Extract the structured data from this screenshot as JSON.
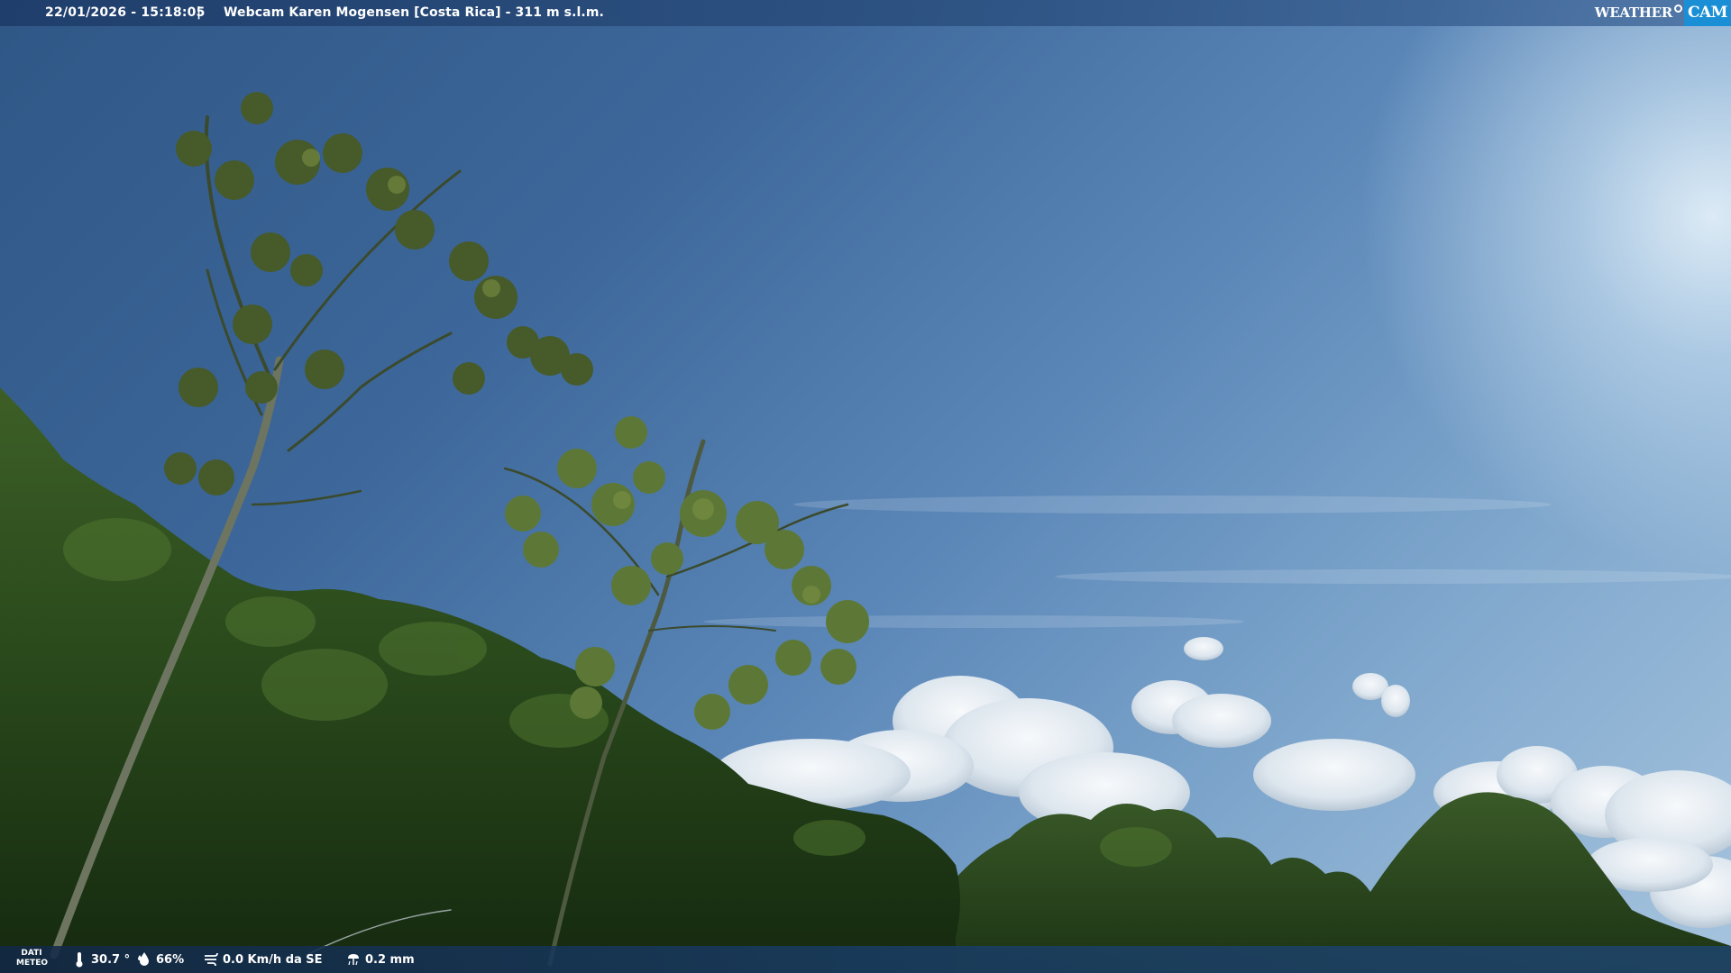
{
  "header": {
    "datetime": "22/01/2026 - 15:18:05",
    "separator": "|",
    "title": "Webcam Karen Mogensen [Costa Rica] - 311 m s.l.m."
  },
  "logo": {
    "word": "WEATHER",
    "cam": "CAM",
    "accent": "#1a8fd6"
  },
  "weather": {
    "label_line1": "DATI",
    "label_line2": "METEO",
    "temperature": "30.7 °",
    "humidity": "66%",
    "wind": "0.0 Km/h da SE",
    "rain": "0.2 mm",
    "icons": {
      "temperature": "thermometer-icon",
      "humidity": "humidity-drop-icon",
      "wind": "wind-icon",
      "rain": "rain-icon"
    }
  }
}
